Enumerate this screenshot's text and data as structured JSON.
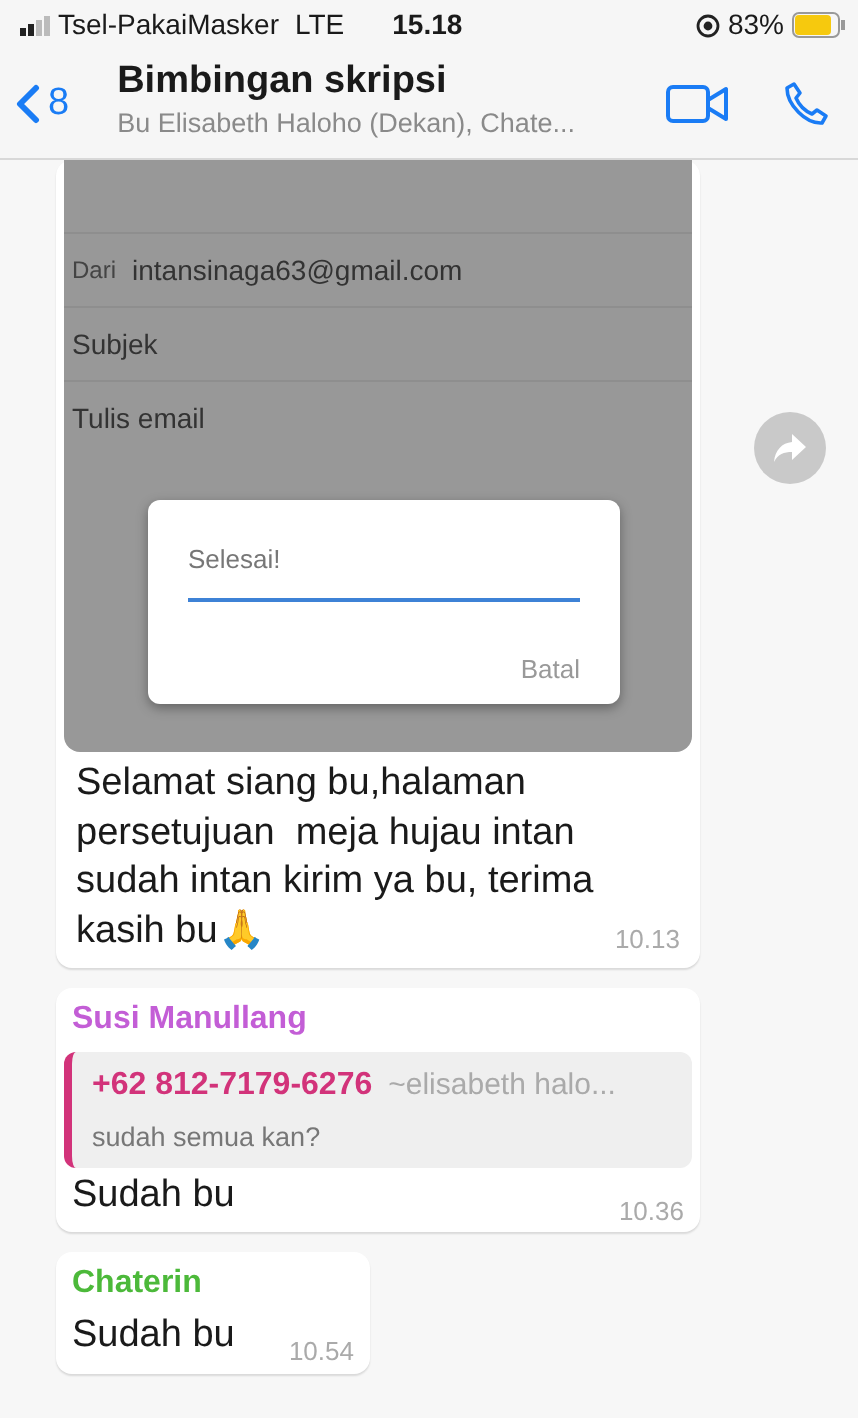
{
  "status_bar": {
    "carrier": "Tsel-PakaiMasker",
    "network": "LTE",
    "time": "15.18",
    "battery": "83%"
  },
  "header": {
    "back_count": "8",
    "title": "Bimbingan skripsi",
    "subtitle": "Bu Elisabeth Haloho (Dekan), Chate..."
  },
  "messages": [
    {
      "kind": "image",
      "email_screenshot": {
        "from_label": "Dari",
        "from_value": "intansinaga63@gmail.com",
        "subject": "Subjek",
        "body_placeholder": "Tulis email",
        "dialog_text": "Selesai!",
        "dialog_button": "Batal"
      },
      "text": "Selamat siang bu,halaman persetujuan  meja hujau intan sudah intan kirim ya bu, terima kasih bu🙏",
      "time": "10.13"
    },
    {
      "kind": "reply",
      "sender": "Susi Manullang",
      "color": "#c35ed6",
      "quote": {
        "name": "+62 812-7179-6276",
        "alias": "~elisabeth halo...",
        "text": "sudah semua kan?",
        "color": "#d2337a"
      },
      "text": "Sudah bu",
      "time": "10.36"
    },
    {
      "kind": "text",
      "sender": "Chaterin",
      "color": "#4cb93a",
      "text": "Sudah bu",
      "time": "10.54"
    }
  ]
}
